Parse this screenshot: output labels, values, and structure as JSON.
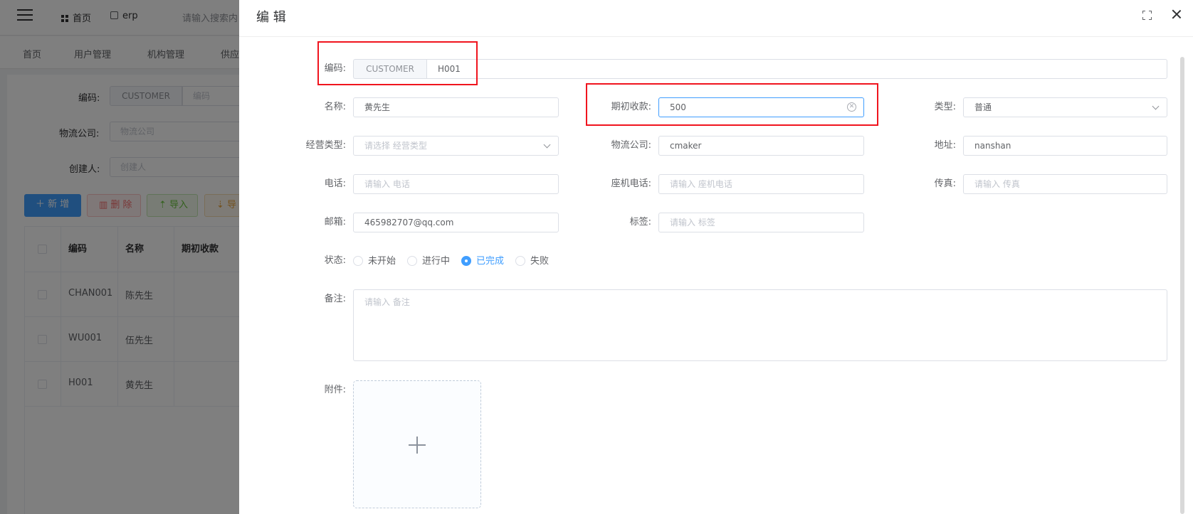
{
  "background": {
    "nav": {
      "home": "首页",
      "app": "erp",
      "search_placeholder": "请输入搜索内"
    },
    "tabs": [
      "首页",
      "用户管理",
      "机构管理",
      "供应"
    ],
    "search": {
      "code_label": "编码:",
      "code_prefix": "CUSTOMER",
      "code_placeholder": "编码",
      "logistics_label": "物流公司:",
      "logistics_placeholder": "物流公司",
      "creator_label": "创建人:",
      "creator_placeholder": "创建人"
    },
    "toolbar": {
      "add": "新 增",
      "delete": "删 除",
      "import": "导入",
      "export": "导"
    },
    "table": {
      "headers": [
        "编码",
        "名称",
        "期初收款"
      ],
      "rows": [
        {
          "code": "CHAN001",
          "name": "陈先生"
        },
        {
          "code": "WU001",
          "name": "伍先生"
        },
        {
          "code": "H001",
          "name": "黄先生"
        }
      ]
    }
  },
  "drawer": {
    "title": "编 辑",
    "fields": {
      "code": {
        "label": "编码:",
        "prefix": "CUSTOMER",
        "value": "H001"
      },
      "name": {
        "label": "名称:",
        "value": "黄先生"
      },
      "initial_receipt": {
        "label": "期初收款:",
        "value": "500"
      },
      "type": {
        "label": "类型:",
        "value": "普通"
      },
      "business_type": {
        "label": "经营类型:",
        "placeholder": "请选择 经营类型"
      },
      "logistics": {
        "label": "物流公司:",
        "value": "cmaker"
      },
      "address": {
        "label": "地址:",
        "value": "nanshan"
      },
      "phone": {
        "label": "电话:",
        "placeholder": "请输入 电话"
      },
      "landline": {
        "label": "座机电话:",
        "placeholder": "请输入 座机电话"
      },
      "fax": {
        "label": "传真:",
        "placeholder": "请输入 传真"
      },
      "email": {
        "label": "邮箱:",
        "value": "465982707@qq.com"
      },
      "tag": {
        "label": "标签:",
        "placeholder": "请输入 标签"
      },
      "status": {
        "label": "状态:",
        "options": [
          "未开始",
          "进行中",
          "已完成",
          "失败"
        ],
        "selected": "已完成"
      },
      "remark": {
        "label": "备注:",
        "placeholder": "请输入 备注"
      },
      "attachment": {
        "label": "附件:"
      }
    }
  },
  "colors": {
    "primary": "#409eff",
    "highlight": "#f0141e",
    "danger": "#f56c6c",
    "success": "#67c23a",
    "warning": "#e6a23c"
  }
}
